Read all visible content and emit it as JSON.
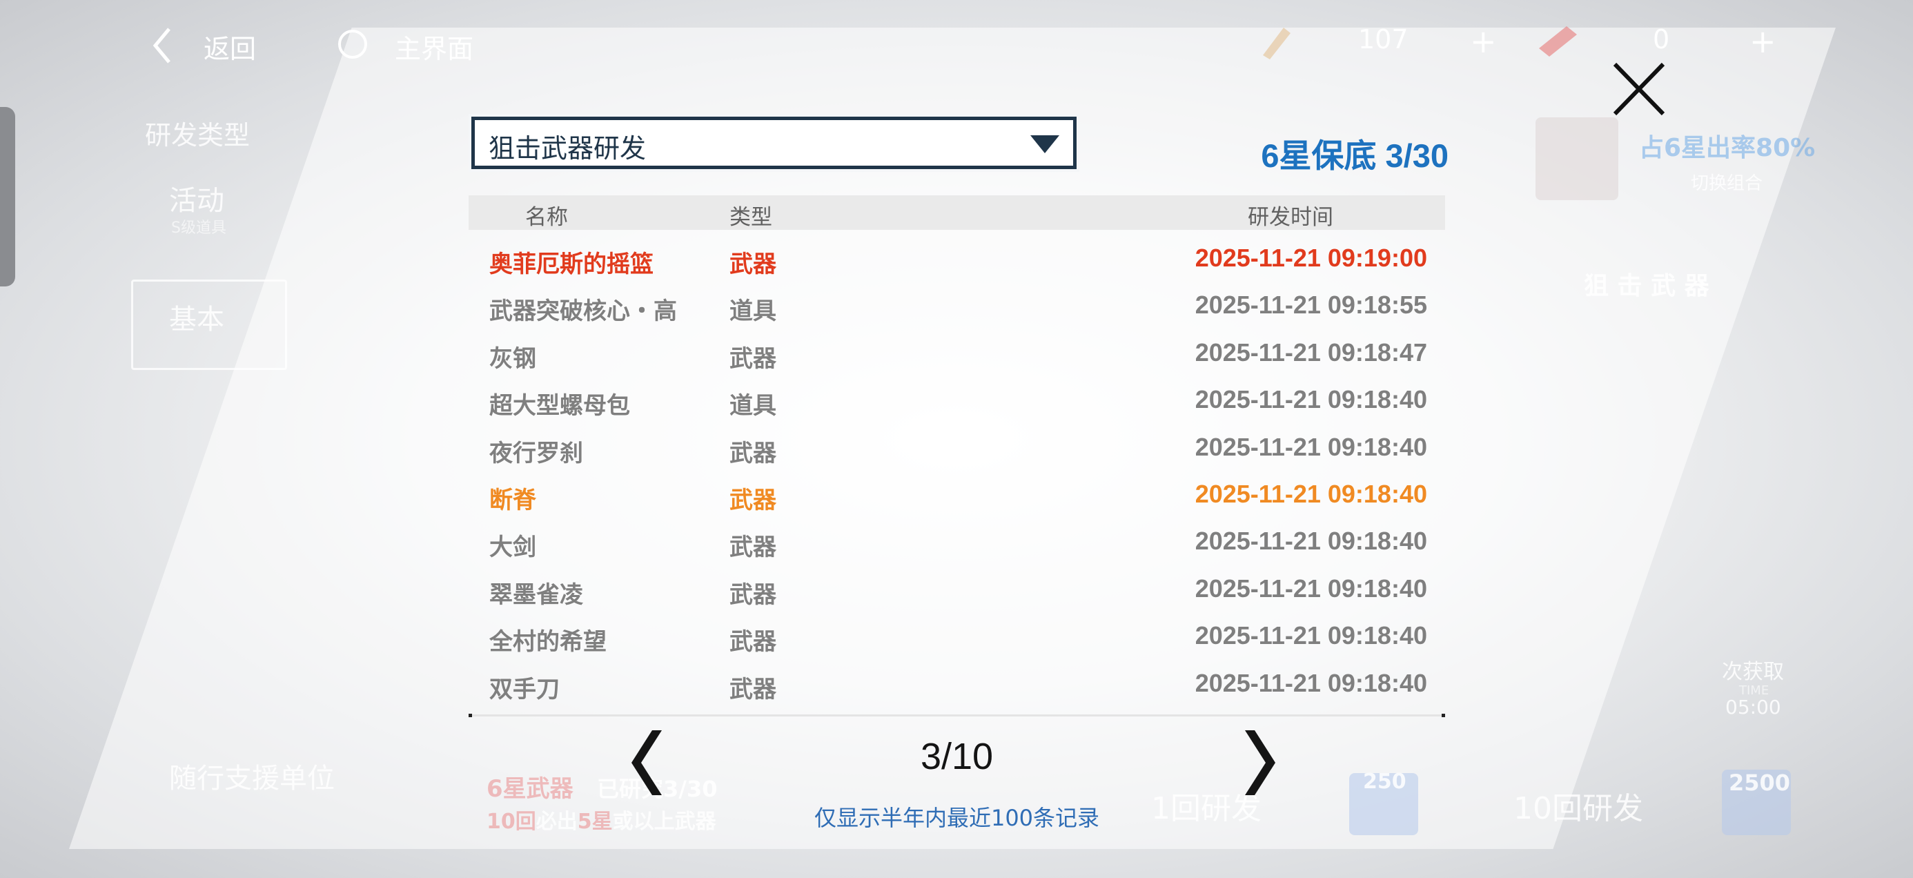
{
  "topbar": {
    "back_label": "返回",
    "home_label": "主界面",
    "currency1_value": "107",
    "currency2_value": "0",
    "plus": "+"
  },
  "background": {
    "research_type_label": "研发类型",
    "activity_label": "活动",
    "activity_sub": "S级道具",
    "basic_label": "基本",
    "support_unit_label": "随行支援单位",
    "six_star_rate": "占6星出率80%",
    "switch_combo": "切换组合",
    "sniper_weapon": "狙 击 武 器",
    "six_star_weapon_label": "6星武器",
    "obtained": "已研究3/30",
    "ten_guarantee_prefix": "10回",
    "ten_guarantee_mid": "必出",
    "ten_guarantee_five": "5星",
    "ten_guarantee_suffix": "或以上武器",
    "one_research": "1回研发",
    "ten_research": "10回研发",
    "cost_one": "250",
    "cost_ten": "2500",
    "free_get": "次获取",
    "time": "05:00",
    "time_label": "TIME"
  },
  "dialog": {
    "dropdown_value": "狙击武器研发",
    "pity": "6星保底 3/30",
    "headers": {
      "name": "名称",
      "type": "类型",
      "time": "研发时间"
    },
    "rows": [
      {
        "name": "奥菲厄斯的摇篮",
        "type": "武器",
        "time": "2025-11-21 09:19:00",
        "rarity": "red"
      },
      {
        "name": "武器突破核心・高",
        "type": "道具",
        "time": "2025-11-21 09:18:55",
        "rarity": "normal"
      },
      {
        "name": "灰钢",
        "type": "武器",
        "time": "2025-11-21 09:18:47",
        "rarity": "normal"
      },
      {
        "name": "超大型螺母包",
        "type": "道具",
        "time": "2025-11-21 09:18:40",
        "rarity": "normal"
      },
      {
        "name": "夜行罗刹",
        "type": "武器",
        "time": "2025-11-21 09:18:40",
        "rarity": "normal"
      },
      {
        "name": "断脊",
        "type": "武器",
        "time": "2025-11-21 09:18:40",
        "rarity": "orange"
      },
      {
        "name": "大剑",
        "type": "武器",
        "time": "2025-11-21 09:18:40",
        "rarity": "normal"
      },
      {
        "name": "翠墨雀凌",
        "type": "武器",
        "time": "2025-11-21 09:18:40",
        "rarity": "normal"
      },
      {
        "name": "全村的希望",
        "type": "武器",
        "time": "2025-11-21 09:18:40",
        "rarity": "normal"
      },
      {
        "name": "双手刀",
        "type": "武器",
        "time": "2025-11-21 09:18:40",
        "rarity": "normal"
      }
    ],
    "page": "3/10",
    "note": "仅显示半年内最近100条记录"
  },
  "colors": {
    "accent_blue": "#1d72bf",
    "six_star_red": "#e13b1d",
    "five_star_orange": "#f08a22",
    "normal_grey": "#7f7f7f"
  },
  "icons": {
    "back": "chevron-left-icon",
    "home": "circle-icon",
    "close": "close-icon",
    "prev": "chevron-left-icon",
    "next": "chevron-right-icon",
    "dropdown": "triangle-down-icon"
  }
}
